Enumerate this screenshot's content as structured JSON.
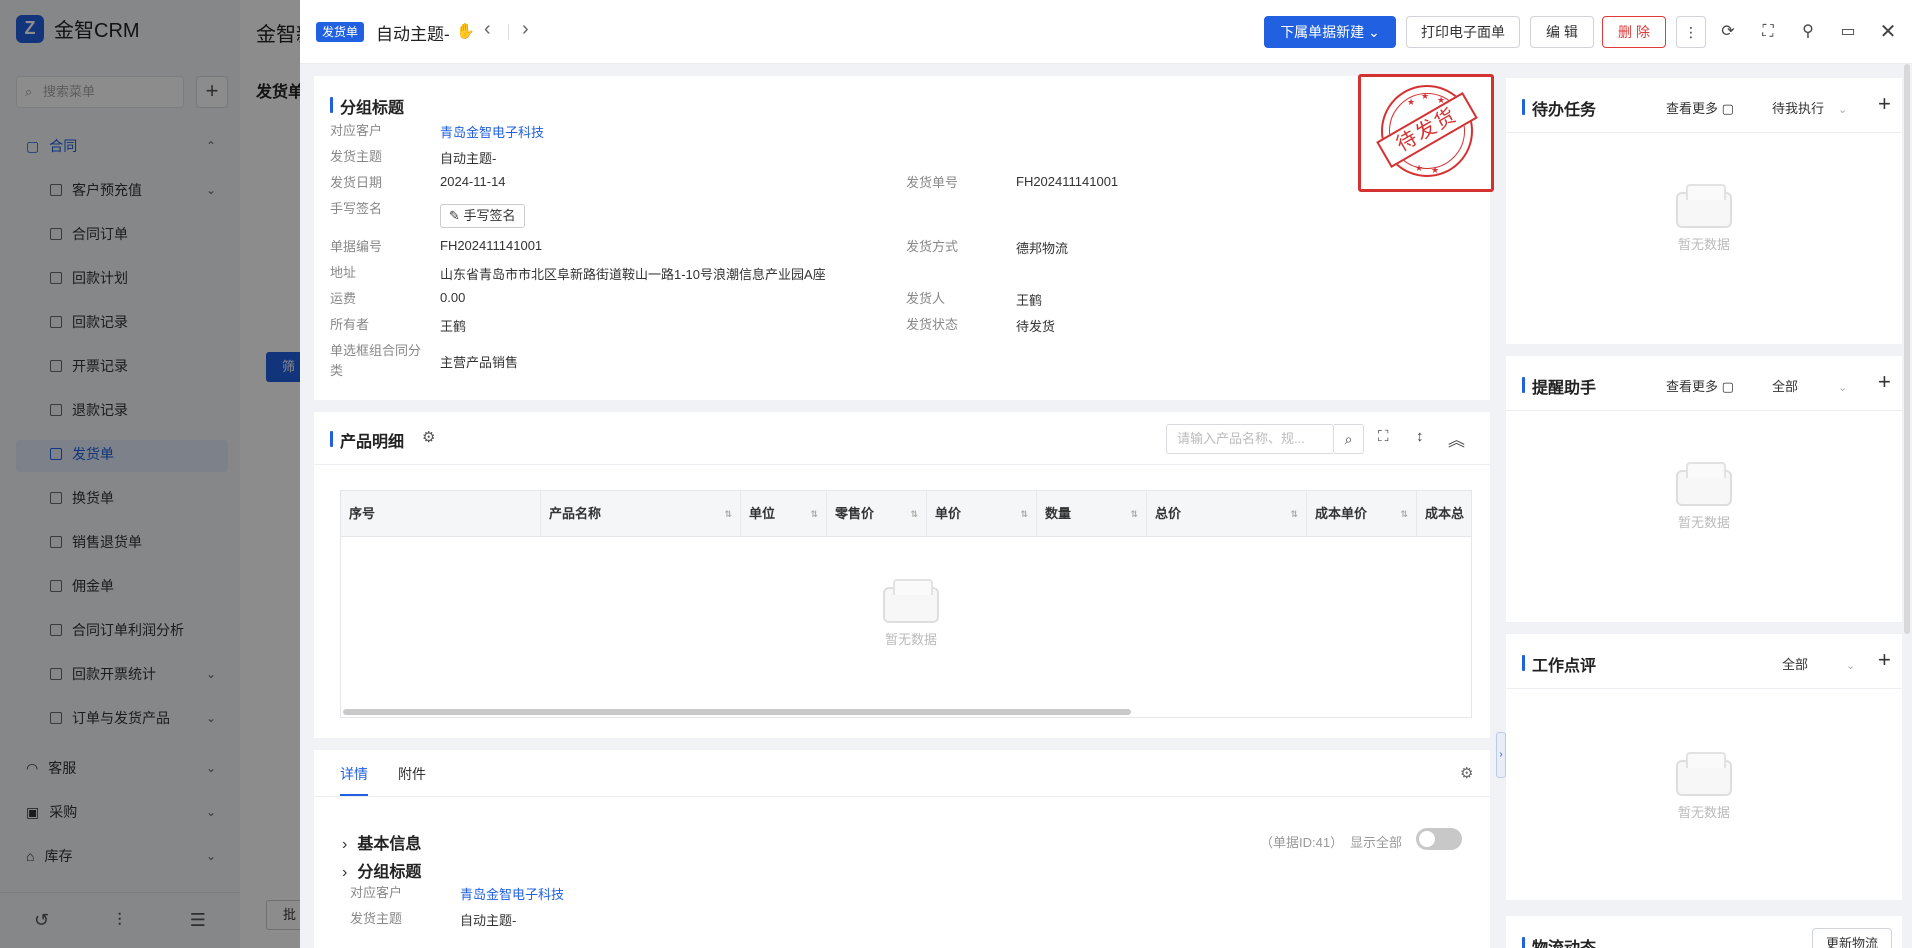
{
  "app": {
    "logo_mark": "Z",
    "logo_text": "金智CRM"
  },
  "sidebar": {
    "search_placeholder": "搜索菜单",
    "add": "+",
    "contract_group": "合同",
    "items": [
      {
        "label": "客户预充值",
        "has_arrow": true
      },
      {
        "label": "合同订单",
        "has_arrow": false
      },
      {
        "label": "回款计划",
        "has_arrow": false
      },
      {
        "label": "回款记录",
        "has_arrow": false
      },
      {
        "label": "开票记录",
        "has_arrow": false
      },
      {
        "label": "退款记录",
        "has_arrow": false
      },
      {
        "label": "发货单",
        "has_arrow": false
      },
      {
        "label": "换货单",
        "has_arrow": false
      },
      {
        "label": "销售退货单",
        "has_arrow": false
      },
      {
        "label": "佣金单",
        "has_arrow": false
      },
      {
        "label": "合同订单利润分析",
        "has_arrow": false
      },
      {
        "label": "回款开票统计",
        "has_arrow": true
      },
      {
        "label": "订单与发货产品",
        "has_arrow": true
      }
    ],
    "groups": [
      "客服",
      "采购",
      "库存"
    ]
  },
  "background": {
    "title": "金智新",
    "subtitle": "发货单",
    "button": "筛",
    "batch": "批"
  },
  "header": {
    "tag": "发货单",
    "title": "自动主题-",
    "prev": "‹",
    "next": "›",
    "btn_new_sub": "下属单据新建",
    "btn_print": "打印电子面单",
    "btn_edit": "编 辑",
    "btn_delete": "删 除"
  },
  "stamp": {
    "text": "待发货"
  },
  "group_section": {
    "title": "分组标题",
    "fields": {
      "customer_label": "对应客户",
      "customer_value": "青岛金智电子科技",
      "subject_label": "发货主题",
      "subject_value": "自动主题-",
      "date_label": "发货日期",
      "date_value": "2024-11-14",
      "ship_no_label": "发货单号",
      "ship_no_value": "FH202411141001",
      "sign_label": "手写签名",
      "sign_button": "手写签名",
      "doc_no_label": "单据编号",
      "doc_no_value": "FH202411141001",
      "method_label": "发货方式",
      "method_value": "德邦物流",
      "address_label": "地址",
      "address_value": "山东省青岛市市北区阜新路街道鞍山一路1-10号浪潮信息产业园A座",
      "freight_label": "运费",
      "freight_value": "0.00",
      "shipper_label": "发货人",
      "shipper_value": "王鹤",
      "owner_label": "所有者",
      "owner_value": "王鹤",
      "status_label": "发货状态",
      "status_value": "待发货",
      "category_label_1": "单选框组合同分",
      "category_label_2": "类",
      "category_value": "主营产品销售"
    }
  },
  "products": {
    "title": "产品明细",
    "search_placeholder": "请输入产品名称、规...",
    "columns": [
      "序号",
      "产品名称",
      "单位",
      "零售价",
      "单价",
      "数量",
      "总价",
      "成本单价",
      "成本总"
    ],
    "empty": "暂无数据"
  },
  "detail": {
    "tabs": [
      "详情",
      "附件"
    ],
    "groups": [
      "基本信息",
      "分组标题"
    ],
    "doc_id": "（单据ID:41）",
    "show_all": "显示全部",
    "customer_label": "对应客户",
    "customer_value": "青岛金智电子科技",
    "subject_label": "发货主题",
    "subject_value": "自动主题-"
  },
  "right": {
    "todo": {
      "title": "待办任务",
      "more": "查看更多",
      "filter": "待我执行",
      "empty": "暂无数据"
    },
    "reminder": {
      "title": "提醒助手",
      "more": "查看更多",
      "filter": "全部",
      "empty": "暂无数据"
    },
    "review": {
      "title": "工作点评",
      "filter": "全部",
      "empty": "暂无数据"
    },
    "logistics": {
      "title": "物流动态",
      "button": "更新物流"
    }
  },
  "icons": {
    "search": "search-icon",
    "refresh": "refresh-icon",
    "fullscreen": "fullscreen-icon",
    "link": "link-icon",
    "monitor": "monitor-icon",
    "close": "close-icon",
    "gear": "gear-icon",
    "plus": "plus-icon"
  },
  "colors": {
    "primary": "#2160e0",
    "danger": "#e03a3a",
    "stamp": "#d63131"
  }
}
